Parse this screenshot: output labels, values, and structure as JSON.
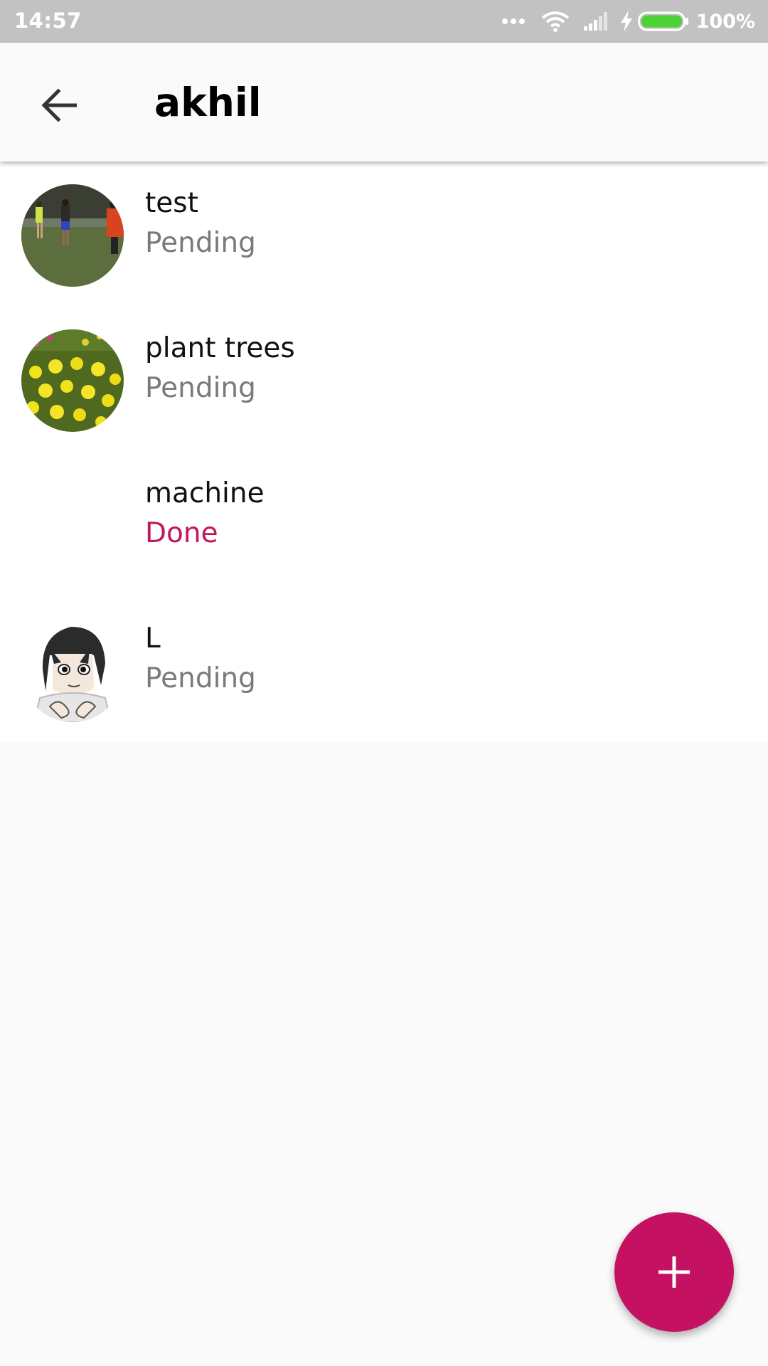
{
  "status_bar": {
    "time": "14:57",
    "battery_percent": "100%",
    "icons": [
      "more-dots-icon",
      "wifi-icon",
      "cell-signal-icon",
      "charging-bolt-icon",
      "battery-icon"
    ]
  },
  "app_bar": {
    "title": "akhil",
    "back_icon": "arrow-back-icon"
  },
  "tasks": [
    {
      "title": "test",
      "status": "Pending",
      "avatar": "photo-football-players"
    },
    {
      "title": "plant trees",
      "status": "Pending",
      "avatar": "photo-yellow-flowers"
    },
    {
      "title": "machine",
      "status": "Done",
      "avatar": "none"
    },
    {
      "title": "L",
      "status": "Pending",
      "avatar": "anime-character-drawing"
    }
  ],
  "fab": {
    "icon": "plus-icon"
  },
  "colors": {
    "accent": "#c51162",
    "done_status": "#c2185b",
    "pending_status": "#7a7a7a",
    "status_bar": "#c2c2c2",
    "battery": "#4cd137"
  }
}
